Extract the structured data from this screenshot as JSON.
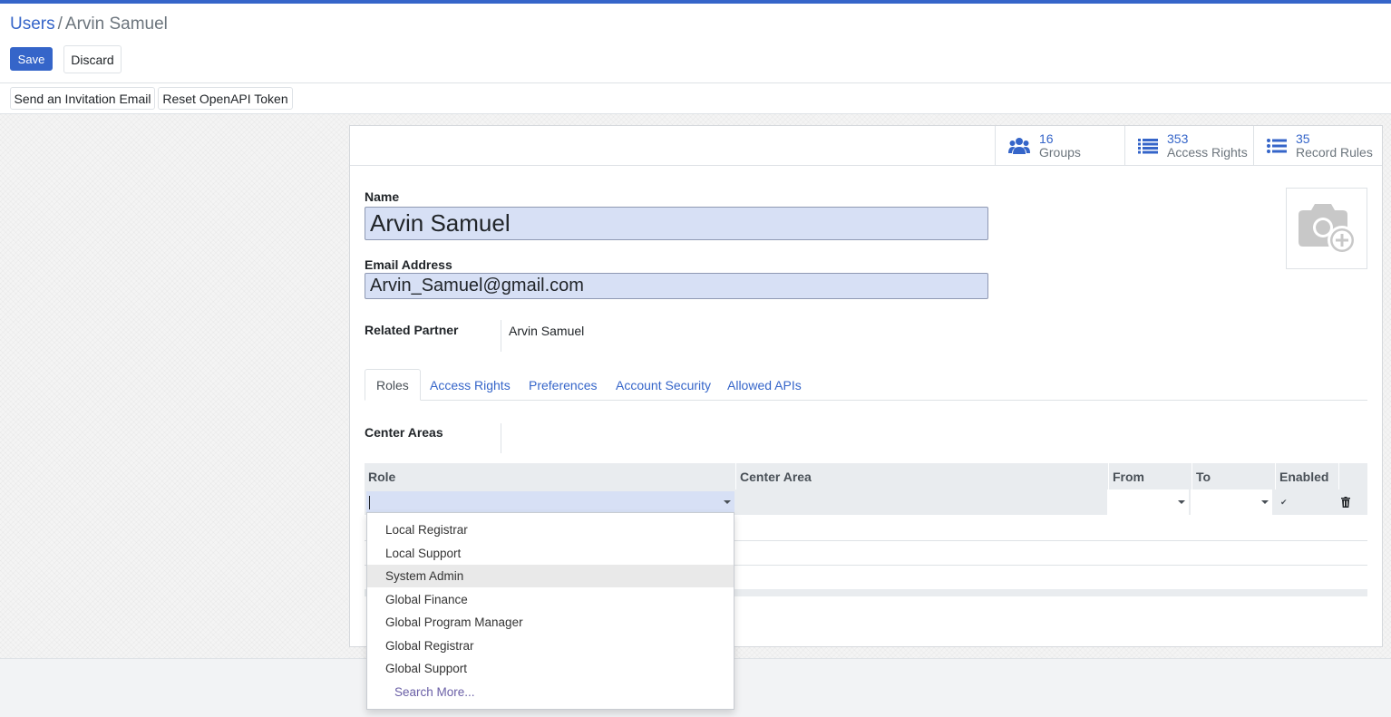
{
  "breadcrumb": {
    "parent": "Users",
    "separator": "/",
    "current": "Arvin Samuel"
  },
  "toolbar": {
    "save": "Save",
    "discard": "Discard"
  },
  "actions": {
    "invite": "Send an Invitation Email",
    "reset_token": "Reset OpenAPI Token"
  },
  "stats": [
    {
      "count": "16",
      "label": "Groups",
      "icon": "users-icon"
    },
    {
      "count": "353",
      "label": "Access Rights",
      "icon": "list-icon"
    },
    {
      "count": "35",
      "label": "Record Rules",
      "icon": "list-icon"
    }
  ],
  "form": {
    "name_label": "Name",
    "name_value": "Arvin Samuel",
    "email_label": "Email Address",
    "email_value": "Arvin_Samuel@gmail.com",
    "partner_label": "Related Partner",
    "partner_value": "Arvin Samuel",
    "avatar_icon": "camera-plus-icon"
  },
  "tabs": [
    "Roles",
    "Access Rights",
    "Preferences",
    "Account Security",
    "Allowed APIs"
  ],
  "roles_tab": {
    "center_areas_label": "Center Areas",
    "columns": [
      "Role",
      "Center Area",
      "From",
      "To",
      "Enabled"
    ],
    "edit_row": {
      "role": "",
      "center_area": "",
      "from": "",
      "to": "",
      "enabled": true
    }
  },
  "role_dropdown": {
    "options": [
      "Local Registrar",
      "Local Support",
      "System Admin",
      "Global Finance",
      "Global Program Manager",
      "Global Registrar",
      "Global Support"
    ],
    "highlighted": "System Admin",
    "search_more": "Search More..."
  },
  "colors": {
    "primary": "#3565c9",
    "input_bg": "#d7e0f5"
  }
}
